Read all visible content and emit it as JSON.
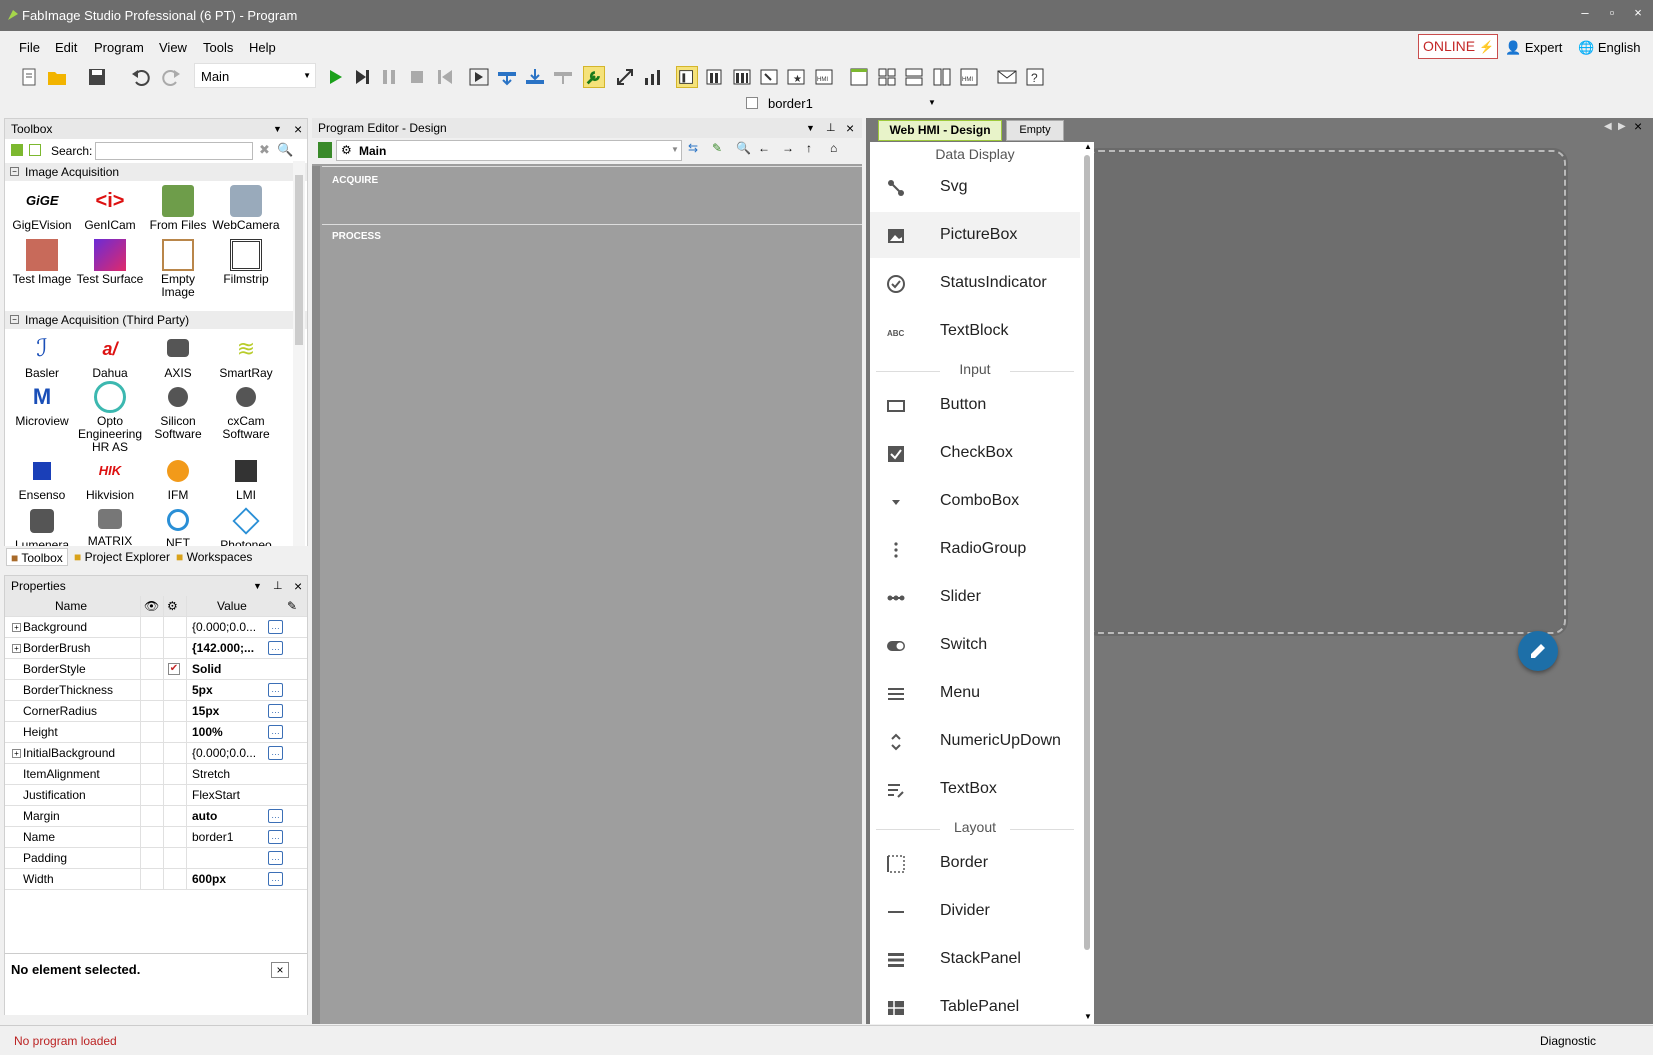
{
  "window": {
    "title": "FabImage Studio Professional (6 PT) - Program",
    "minimize": "–",
    "maximize": "▫",
    "close": "×"
  },
  "menu": [
    "File",
    "Edit",
    "Program",
    "View",
    "Tools",
    "Help"
  ],
  "topright": {
    "online": "ONLINE",
    "expert": "Expert",
    "language": "English"
  },
  "toolbar": {
    "program_combo": "Main",
    "selected_element": "border1"
  },
  "toolbox": {
    "title": "Toolbox",
    "search_label": "Search:",
    "search_value": "",
    "groups": [
      {
        "name": "Image Acquisition",
        "items": [
          "GigEVision",
          "GenICam",
          "From Files",
          "WebCamera",
          "Test Image",
          "Test Surface",
          "Empty Image",
          "Filmstrip"
        ]
      },
      {
        "name": "Image Acquisition (Third Party)",
        "items": [
          "Basler",
          "Dahua",
          "AXIS",
          "SmartRay",
          "Microview",
          "Opto Engineering HR AS",
          "Silicon Software",
          "cxCam Software",
          "Ensenso",
          "Hikvision",
          "IFM",
          "LMI",
          "Lumenera",
          "MATRIX",
          "NET",
          "Photoneo"
        ]
      }
    ],
    "bottom_tabs": [
      "Toolbox",
      "Project Explorer",
      "Workspaces"
    ]
  },
  "properties": {
    "title": "Properties",
    "col_name": "Name",
    "col_value": "Value",
    "rows": [
      {
        "name": "Background",
        "value": "{0.000;0.0...",
        "expandable": true,
        "button": true
      },
      {
        "name": "BorderBrush",
        "value": "{142.000;...",
        "expandable": true,
        "button": true
      },
      {
        "name": "BorderStyle",
        "value": "Solid",
        "checked": true
      },
      {
        "name": "BorderThickness",
        "value": "5px",
        "button": true
      },
      {
        "name": "CornerRadius",
        "value": "15px",
        "button": true
      },
      {
        "name": "Height",
        "value": "100%",
        "button": true
      },
      {
        "name": "InitialBackground",
        "value": "{0.000;0.0...",
        "expandable": true,
        "button": true
      },
      {
        "name": "ItemAlignment",
        "value": "Stretch"
      },
      {
        "name": "Justification",
        "value": "FlexStart"
      },
      {
        "name": "Margin",
        "value": "auto",
        "button": true
      },
      {
        "name": "Name",
        "value": "border1",
        "button": true
      },
      {
        "name": "Padding",
        "value": "",
        "button": true
      },
      {
        "name": "Width",
        "value": "600px",
        "button": true
      }
    ],
    "no_element": "No element selected."
  },
  "editor": {
    "title": "Program Editor - Design",
    "program": "Main",
    "sections": [
      "ACQUIRE",
      "PROCESS"
    ]
  },
  "hmi": {
    "tabs": [
      "Web HMI - Design",
      "Empty View"
    ],
    "palette": [
      {
        "header": "Data Display",
        "items": [
          {
            "label": "Svg",
            "icon": "svg-icon"
          },
          {
            "label": "PictureBox",
            "icon": "picture-icon"
          },
          {
            "label": "StatusIndicator",
            "icon": "status-icon"
          },
          {
            "label": "TextBlock",
            "icon": "textblock-icon"
          }
        ]
      },
      {
        "header": "Input",
        "items": [
          {
            "label": "Button",
            "icon": "button-icon"
          },
          {
            "label": "CheckBox",
            "icon": "checkbox-icon"
          },
          {
            "label": "ComboBox",
            "icon": "combobox-icon"
          },
          {
            "label": "RadioGroup",
            "icon": "radiogroup-icon"
          },
          {
            "label": "Slider",
            "icon": "slider-icon"
          },
          {
            "label": "Switch",
            "icon": "switch-icon"
          },
          {
            "label": "Menu",
            "icon": "menu-icon"
          },
          {
            "label": "NumericUpDown",
            "icon": "numeric-icon"
          },
          {
            "label": "TextBox",
            "icon": "textbox-icon"
          }
        ]
      },
      {
        "header": "Layout",
        "items": [
          {
            "label": "Border",
            "icon": "border-icon"
          },
          {
            "label": "Divider",
            "icon": "divider-icon"
          },
          {
            "label": "StackPanel",
            "icon": "stackpanel-icon"
          },
          {
            "label": "TablePanel",
            "icon": "tablepanel-icon"
          }
        ]
      }
    ]
  },
  "status": {
    "left": "No program loaded",
    "right": "Diagnostic"
  },
  "colors": {
    "accent": "#9ec93a",
    "online": "#c42828",
    "fab": "#1d6fa8"
  }
}
